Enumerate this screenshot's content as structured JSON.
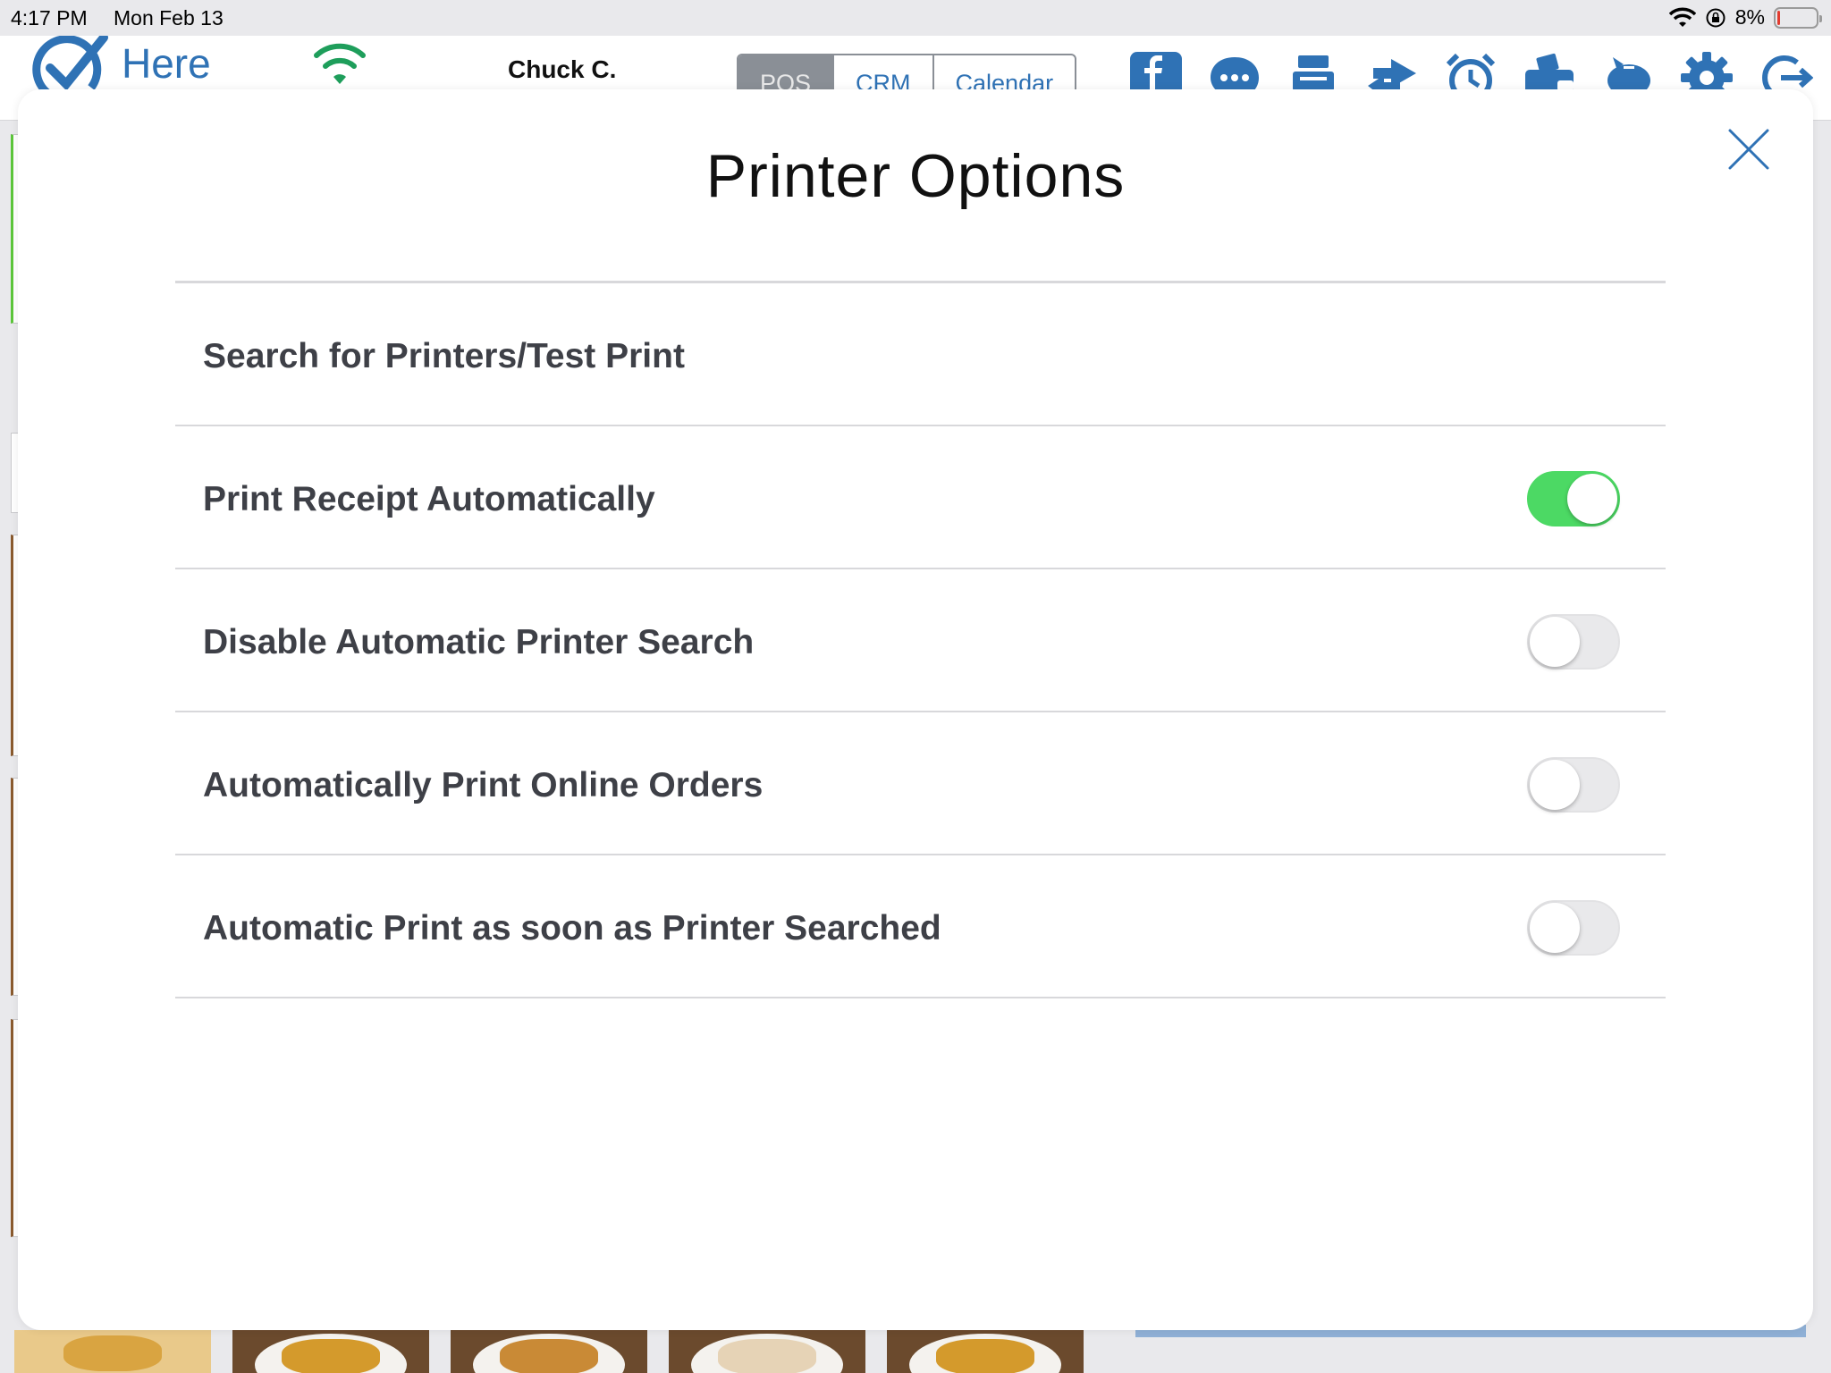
{
  "status_bar": {
    "time": "4:17 PM",
    "date": "Mon Feb 13",
    "battery": "8%",
    "battery_level_percent": 8,
    "icons": [
      "wifi-icon",
      "orientation-lock-icon",
      "battery-icon"
    ]
  },
  "app_header": {
    "logo_text": "Here",
    "user_name": "Chuck C.",
    "tabs": [
      {
        "label": "POS",
        "active": true
      },
      {
        "label": "CRM",
        "active": false
      },
      {
        "label": "Calendar",
        "active": false
      }
    ],
    "toolbar_icons": [
      "facebook-icon",
      "chat-icon",
      "register-icon",
      "transfer-icon",
      "alarm-icon",
      "wallet-icon",
      "piggy-bank-icon",
      "gear-icon",
      "logout-icon"
    ],
    "colors": {
      "accent": "#2f72b5",
      "connected": "#1e9e5b"
    }
  },
  "modal": {
    "title": "Printer Options",
    "close_icon": "close-icon",
    "options": [
      {
        "label": "Search for Printers/Test Print",
        "has_toggle": false
      },
      {
        "label": "Print Receipt Automatically",
        "has_toggle": true,
        "enabled": true
      },
      {
        "label": "Disable Automatic Printer Search",
        "has_toggle": true,
        "enabled": false
      },
      {
        "label": "Automatically Print Online Orders",
        "has_toggle": true,
        "enabled": false
      },
      {
        "label": "Automatic Print as soon as Printer Searched",
        "has_toggle": true,
        "enabled": false
      }
    ],
    "colors": {
      "toggle_on": "#4cd964",
      "toggle_off": "#e9e9eb",
      "accent": "#2f72b5"
    }
  }
}
